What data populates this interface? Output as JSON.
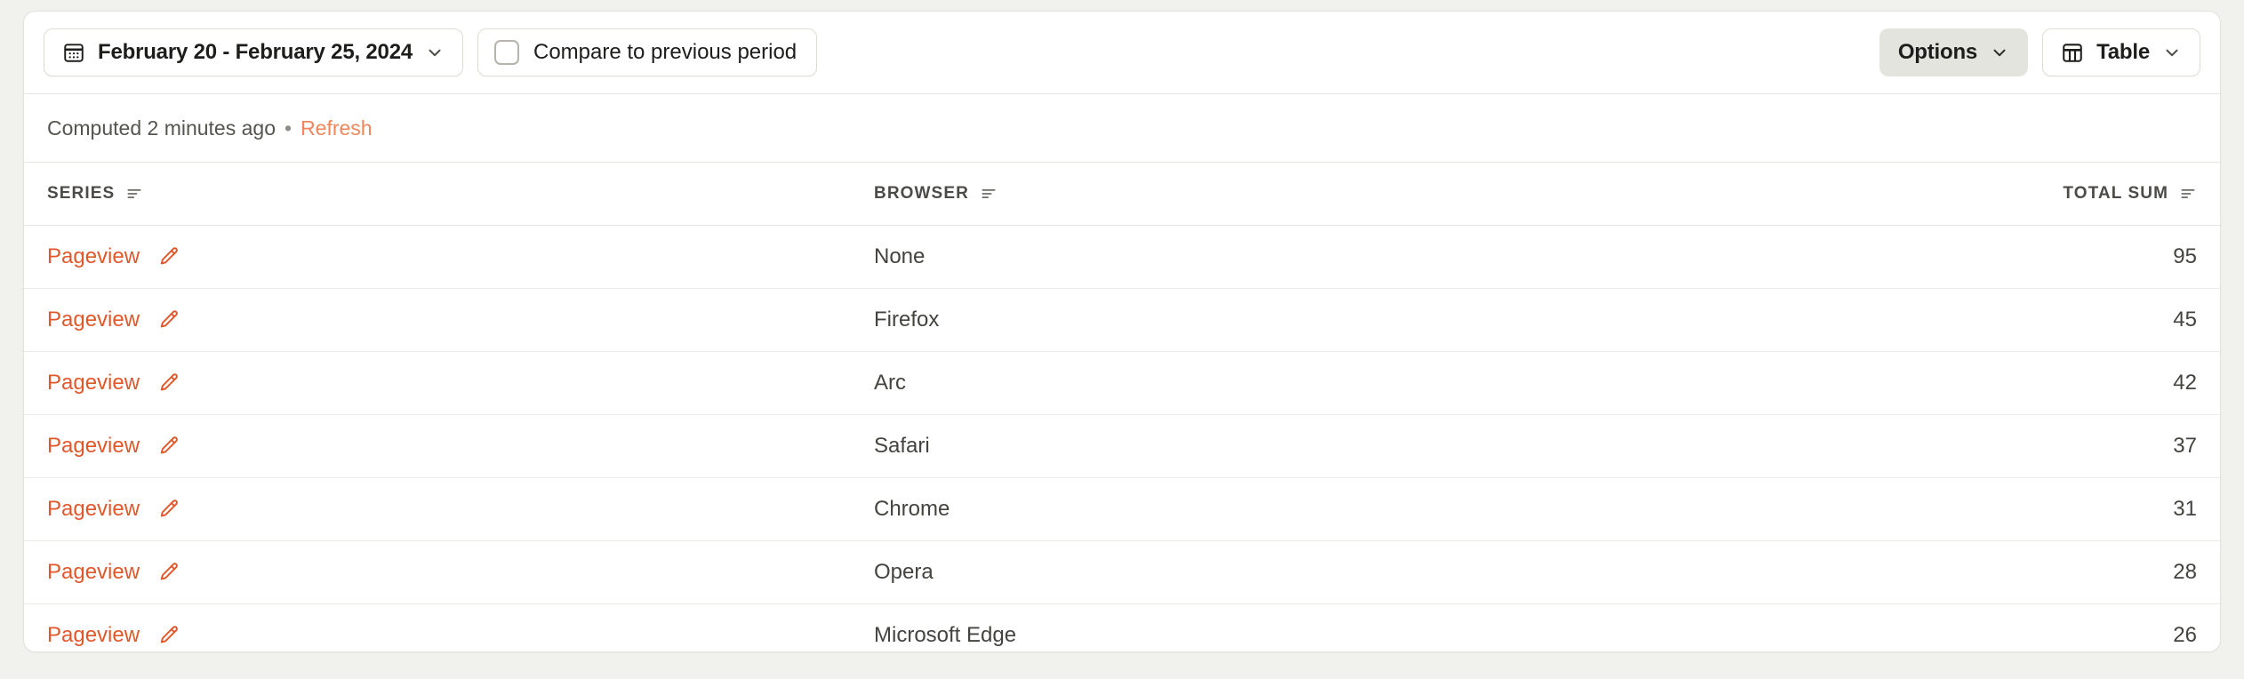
{
  "toolbar": {
    "date_range": {
      "label": "February 20 - February 25, 2024",
      "icon": "calendar-icon",
      "chevron": "chevron-down-icon"
    },
    "compare": {
      "label": "Compare to previous period",
      "checked": false
    },
    "options": {
      "label": "Options",
      "chevron": "chevron-down-icon"
    },
    "view": {
      "label": "Table",
      "icon": "table-icon",
      "chevron": "chevron-down-icon"
    }
  },
  "status": {
    "computed_text": "Computed 2 minutes ago",
    "separator": "•",
    "refresh_label": "Refresh"
  },
  "table": {
    "columns": [
      {
        "label": "SERIES",
        "sort_icon": "sort-icon",
        "align": "left"
      },
      {
        "label": "BROWSER",
        "sort_icon": "sort-icon",
        "align": "left"
      },
      {
        "label": "TOTAL SUM",
        "sort_icon": "sort-icon",
        "align": "right"
      }
    ],
    "rows": [
      {
        "series": "Pageview",
        "edit_icon": "pencil-icon",
        "browser": "None",
        "total_sum": "95"
      },
      {
        "series": "Pageview",
        "edit_icon": "pencil-icon",
        "browser": "Firefox",
        "total_sum": "45"
      },
      {
        "series": "Pageview",
        "edit_icon": "pencil-icon",
        "browser": "Arc",
        "total_sum": "42"
      },
      {
        "series": "Pageview",
        "edit_icon": "pencil-icon",
        "browser": "Safari",
        "total_sum": "37"
      },
      {
        "series": "Pageview",
        "edit_icon": "pencil-icon",
        "browser": "Chrome",
        "total_sum": "31"
      },
      {
        "series": "Pageview",
        "edit_icon": "pencil-icon",
        "browser": "Opera",
        "total_sum": "28"
      },
      {
        "series": "Pageview",
        "edit_icon": "pencil-icon",
        "browser": "Microsoft Edge",
        "total_sum": "26"
      }
    ]
  },
  "colors": {
    "page_background": "#f1f1ee",
    "card_background": "#ffffff",
    "accent_link": "#e2572a",
    "refresh_link": "#f0865c",
    "border": "#e6e5e0",
    "filled_button": "#e4e4df"
  }
}
